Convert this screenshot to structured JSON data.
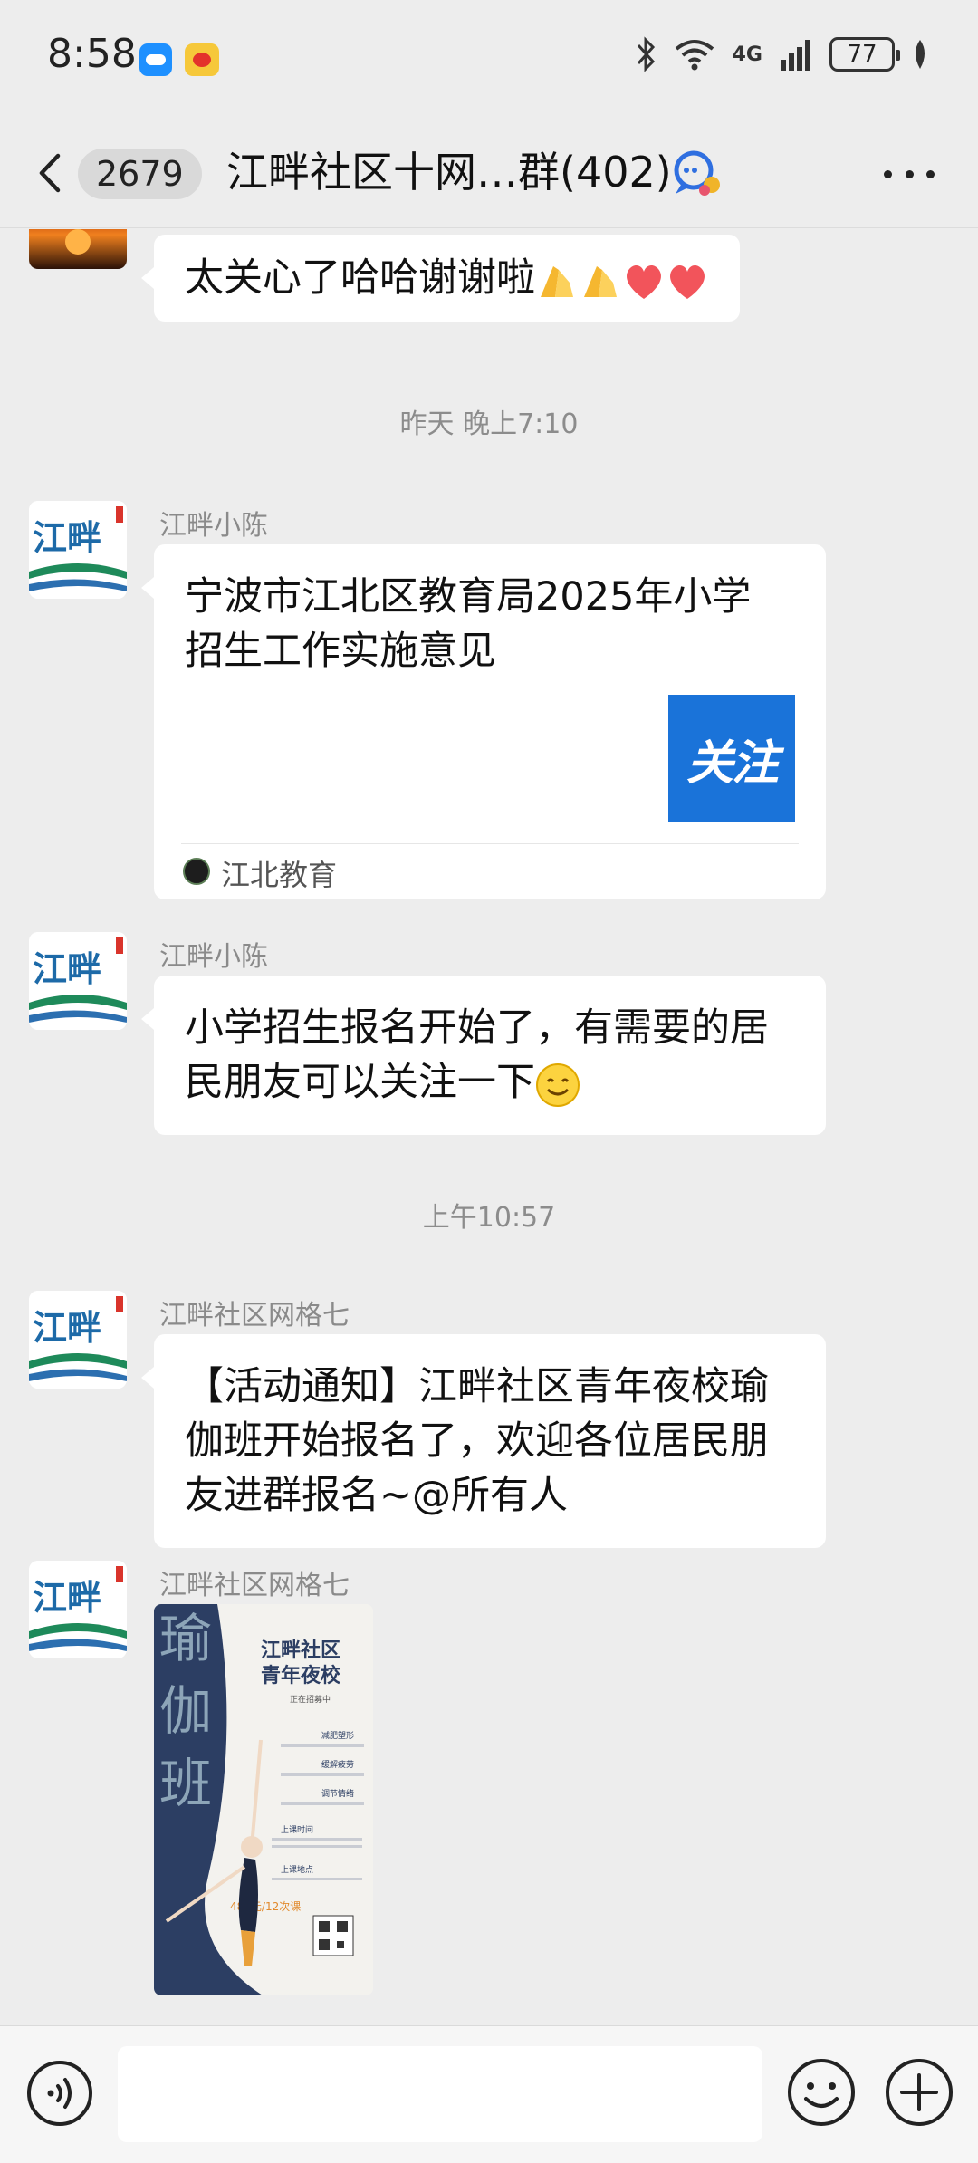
{
  "status_bar": {
    "time": "8:58",
    "network": "4G",
    "battery": "77"
  },
  "nav": {
    "unread_count": "2679",
    "title": "江畔社区十网…群(402)"
  },
  "messages": {
    "m1": {
      "text": "太关心了哈哈谢谢啦"
    },
    "ts1": "昨天 晚上7:10",
    "m2": {
      "sender": "江畔小陈",
      "card_title": "宁波市江北区教育局2025年小学招生工作实施意见",
      "thumb_text": "关注",
      "source": "江北教育"
    },
    "m3": {
      "sender": "江畔小陈",
      "text": "小学招生报名开始了，有需要的居民朋友可以关注一下"
    },
    "ts2": "上午10:57",
    "m4": {
      "sender": "江畔社区网格七",
      "text": "【活动通知】江畔社区青年夜校瑜伽班开始报名了，欢迎各位居民朋友进群报名~@所有人"
    },
    "m5": {
      "sender": "江畔社区网格七",
      "poster": {
        "side_title": "瑜伽班",
        "title1": "江畔社区",
        "title2": "青年夜校",
        "subtitle": "正在招募中",
        "b1": "减肥塑形",
        "b2": "缓解疲劳",
        "b3": "调节情绪",
        "time_label": "上课时间",
        "place_label": "上课地点",
        "price": "480元/12次课"
      }
    }
  },
  "avatar_logo_text": "江畔",
  "input": {
    "placeholder": ""
  },
  "colors": {
    "background": "#ededed",
    "bubble": "#ffffff",
    "logo_green": "#1e8a5a",
    "logo_blue": "#2c6fb0",
    "card_thumb_blue": "#1a73d9"
  }
}
